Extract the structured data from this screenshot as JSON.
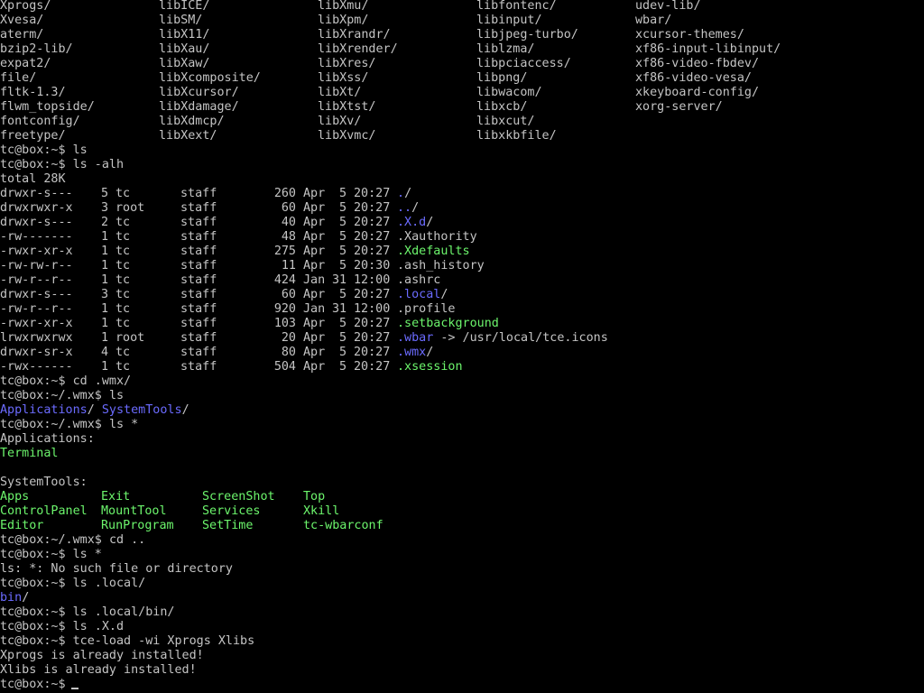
{
  "prompt": "tc@box:~$",
  "wmx_prompt": "tc@box:~/.wmx$",
  "pkg_listing": [
    [
      "Xprogs/",
      "libICE/",
      "libXmu/",
      "libfontenc/",
      "udev-lib/"
    ],
    [
      "Xvesa/",
      "libSM/",
      "libXpm/",
      "libinput/",
      "wbar/"
    ],
    [
      "aterm/",
      "libX11/",
      "libXrandr/",
      "libjpeg-turbo/",
      "xcursor-themes/"
    ],
    [
      "bzip2-lib/",
      "libXau/",
      "libXrender/",
      "liblzma/",
      "xf86-input-libinput/"
    ],
    [
      "expat2/",
      "libXaw/",
      "libXres/",
      "libpciaccess/",
      "xf86-video-fbdev/"
    ],
    [
      "file/",
      "libXcomposite/",
      "libXss/",
      "libpng/",
      "xf86-video-vesa/"
    ],
    [
      "fltk-1.3/",
      "libXcursor/",
      "libXt/",
      "libwacom/",
      "xkeyboard-config/"
    ],
    [
      "flwm_topside/",
      "libXdamage/",
      "libXtst/",
      "libxcb/",
      "xorg-server/"
    ],
    [
      "fontconfig/",
      "libXdmcp/",
      "libXv/",
      "libxcut/",
      ""
    ],
    [
      "freetype/",
      "libXext/",
      "libXvmc/",
      "libxkbfile/",
      ""
    ]
  ],
  "cmd_ls": "ls",
  "cmd_ls_alh": "ls -alh",
  "total": "total 28K",
  "ls_rows": [
    {
      "perm": "drwxr-s---",
      "links": "5",
      "owner": "tc",
      "group": "staff",
      "size": "260",
      "month": "Apr",
      "day": "5",
      "time": "20:27",
      "name": ".",
      "suffix": "/",
      "kind": "dir"
    },
    {
      "perm": "drwxrwxr-x",
      "links": "3",
      "owner": "root",
      "group": "staff",
      "size": "60",
      "month": "Apr",
      "day": "5",
      "time": "20:27",
      "name": "..",
      "suffix": "/",
      "kind": "dir"
    },
    {
      "perm": "drwxr-s---",
      "links": "2",
      "owner": "tc",
      "group": "staff",
      "size": "40",
      "month": "Apr",
      "day": "5",
      "time": "20:27",
      "name": ".X.d",
      "suffix": "/",
      "kind": "dir"
    },
    {
      "perm": "-rw-------",
      "links": "1",
      "owner": "tc",
      "group": "staff",
      "size": "48",
      "month": "Apr",
      "day": "5",
      "time": "20:27",
      "name": ".Xauthority",
      "suffix": "",
      "kind": "file"
    },
    {
      "perm": "-rwxr-xr-x",
      "links": "1",
      "owner": "tc",
      "group": "staff",
      "size": "275",
      "month": "Apr",
      "day": "5",
      "time": "20:27",
      "name": ".Xdefaults",
      "suffix": "",
      "kind": "exe"
    },
    {
      "perm": "-rw-rw-r--",
      "links": "1",
      "owner": "tc",
      "group": "staff",
      "size": "11",
      "month": "Apr",
      "day": "5",
      "time": "20:30",
      "name": ".ash_history",
      "suffix": "",
      "kind": "file"
    },
    {
      "perm": "-rw-r--r--",
      "links": "1",
      "owner": "tc",
      "group": "staff",
      "size": "424",
      "month": "Jan",
      "day": "31",
      "time": "12:00",
      "name": ".ashrc",
      "suffix": "",
      "kind": "file"
    },
    {
      "perm": "drwxr-s---",
      "links": "3",
      "owner": "tc",
      "group": "staff",
      "size": "60",
      "month": "Apr",
      "day": "5",
      "time": "20:27",
      "name": ".local",
      "suffix": "/",
      "kind": "dir"
    },
    {
      "perm": "-rw-r--r--",
      "links": "1",
      "owner": "tc",
      "group": "staff",
      "size": "920",
      "month": "Jan",
      "day": "31",
      "time": "12:00",
      "name": ".profile",
      "suffix": "",
      "kind": "file"
    },
    {
      "perm": "-rwxr-xr-x",
      "links": "1",
      "owner": "tc",
      "group": "staff",
      "size": "103",
      "month": "Apr",
      "day": "5",
      "time": "20:27",
      "name": ".setbackground",
      "suffix": "",
      "kind": "exe"
    },
    {
      "perm": "lrwxrwxrwx",
      "links": "1",
      "owner": "root",
      "group": "staff",
      "size": "20",
      "month": "Apr",
      "day": "5",
      "time": "20:27",
      "name": ".wbar",
      "suffix": " -> /usr/local/tce.icons",
      "kind": "dir"
    },
    {
      "perm": "drwxr-sr-x",
      "links": "4",
      "owner": "tc",
      "group": "staff",
      "size": "80",
      "month": "Apr",
      "day": "5",
      "time": "20:27",
      "name": ".wmx",
      "suffix": "/",
      "kind": "dir"
    },
    {
      "perm": "-rwx------",
      "links": "1",
      "owner": "tc",
      "group": "staff",
      "size": "504",
      "month": "Apr",
      "day": "5",
      "time": "20:27",
      "name": ".xsession",
      "suffix": "",
      "kind": "exe"
    }
  ],
  "cmd_cd_wmx": "cd .wmx/",
  "wmx_dirs": [
    {
      "name": "Applications",
      "suffix": "/"
    },
    {
      "name": "SystemTools",
      "suffix": "/"
    }
  ],
  "cmd_ls_star": "ls *",
  "applications_header": "Applications:",
  "applications_items": [
    "Terminal"
  ],
  "systemtools_header": "SystemTools:",
  "systemtools_grid": [
    [
      "Apps",
      "Exit",
      "ScreenShot",
      "Top"
    ],
    [
      "ControlPanel",
      "MountTool",
      "Services",
      "Xkill"
    ],
    [
      "Editor",
      "RunProgram",
      "SetTime",
      "tc-wbarconf"
    ]
  ],
  "cmd_cd_up": "cd ..",
  "ls_star_error": "ls: *: No such file or directory",
  "cmd_ls_local": "ls .local/",
  "local_entry": {
    "name": "bin",
    "suffix": "/"
  },
  "cmd_ls_local_bin": "ls .local/bin/",
  "cmd_ls_xd": "ls .X.d",
  "cmd_tce_load": "tce-load -wi Xprogs Xlibs",
  "tce_msgs": [
    "Xprogs is already installed!",
    "Xlibs is already installed!"
  ],
  "colors": {
    "background": "#000000",
    "foreground": "#c4c4c4",
    "directory": "#6b6bff",
    "executable": "#6cf56c"
  }
}
